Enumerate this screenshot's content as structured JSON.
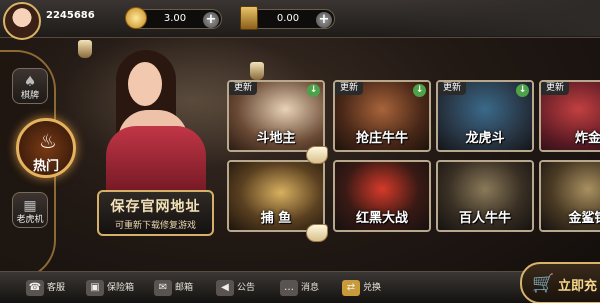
{
  "header": {
    "user_id": "2245686",
    "gold": {
      "value": "3.00",
      "plus": "+"
    },
    "cards": {
      "value": "0.00",
      "plus": "+"
    }
  },
  "sidebar": {
    "items": [
      {
        "label": "棋牌",
        "icon": "cards-icon"
      },
      {
        "label": "热门",
        "icon": "flame-icon"
      },
      {
        "label": "老虎机",
        "icon": "slot-icon"
      }
    ],
    "flame": "♨"
  },
  "promo": {
    "title": "保存官网地址",
    "subtitle": "可重新下载修复游戏"
  },
  "games": [
    {
      "name": "斗地主",
      "badge": "更新",
      "download": "↓"
    },
    {
      "name": "抢庄牛牛",
      "badge": "更新",
      "download": "↓"
    },
    {
      "name": "龙虎斗",
      "badge": "更新",
      "download": "↓"
    },
    {
      "name": "炸金",
      "badge": "更新",
      "download": "↓"
    },
    {
      "name": "捕  鱼",
      "badge": "",
      "download": ""
    },
    {
      "name": "红黑大战",
      "badge": "",
      "download": ""
    },
    {
      "name": "百人牛牛",
      "badge": "",
      "download": ""
    },
    {
      "name": "金鲨银",
      "badge": "",
      "download": ""
    }
  ],
  "bottombar": {
    "items": [
      {
        "label": "客服",
        "icon": "headset-icon",
        "glyph": "☎"
      },
      {
        "label": "保险箱",
        "icon": "safe-icon",
        "glyph": "▣"
      },
      {
        "label": "邮箱",
        "icon": "mail-icon",
        "glyph": "✉"
      },
      {
        "label": "公告",
        "icon": "megaphone-icon",
        "glyph": "◀"
      },
      {
        "label": "消息",
        "icon": "chat-icon",
        "glyph": "…"
      },
      {
        "label": "兑换",
        "icon": "exchange-icon",
        "glyph": "⇄"
      }
    ],
    "shop_label": "立即充"
  }
}
